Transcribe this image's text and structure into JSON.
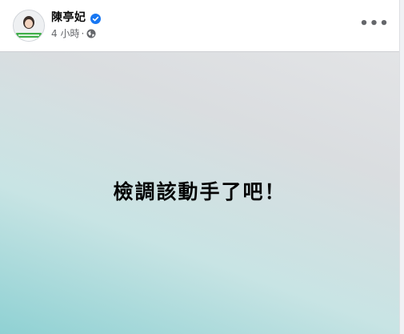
{
  "post": {
    "author": {
      "name": "陳亭妃",
      "verified": true,
      "verified_color": "#1877f2"
    },
    "timestamp": "4 小時",
    "separator": "·",
    "privacy_icon": "globe-icon",
    "more_icon": "more-options-icon",
    "more_label": "•••",
    "content_text": "檢調該動手了吧！",
    "background_colors": [
      "#e3e4e6",
      "#c8e4e4",
      "#8fd1d3"
    ]
  }
}
